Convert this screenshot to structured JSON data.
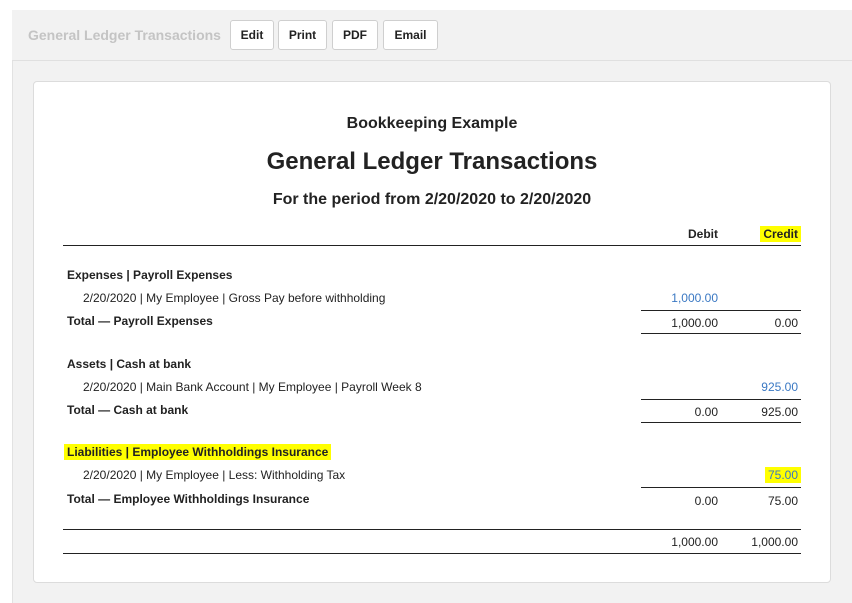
{
  "toolbar": {
    "title": "General Ledger Transactions",
    "buttons": {
      "edit": "Edit",
      "print": "Print",
      "pdf": "PDF",
      "email": "Email"
    }
  },
  "report": {
    "company": "Bookkeeping Example",
    "title": "General Ledger Transactions",
    "period": "For the period from 2/20/2020 to 2/20/2020",
    "columns": {
      "debit": "Debit",
      "credit": "Credit"
    },
    "sections": [
      {
        "heading": "Expenses | Payroll Expenses",
        "line": {
          "description": "2/20/2020 | My Employee | Gross Pay before withholding",
          "debit": "1,000.00",
          "credit": ""
        },
        "total": {
          "label": "Total — Payroll Expenses",
          "debit": "1,000.00",
          "credit": "0.00"
        }
      },
      {
        "heading": "Assets | Cash at bank",
        "line": {
          "description": "2/20/2020 | Main Bank Account | My Employee | Payroll Week 8",
          "debit": "",
          "credit": "925.00"
        },
        "total": {
          "label": "Total — Cash at bank",
          "debit": "0.00",
          "credit": "925.00"
        }
      },
      {
        "heading": "Liabilities | Employee Withholdings Insurance",
        "line": {
          "description": "2/20/2020 | My Employee | Less: Withholding Tax",
          "debit": "",
          "credit": "75.00"
        },
        "total": {
          "label": "Total — Employee Withholdings Insurance",
          "debit": "0.00",
          "credit": "75.00"
        }
      }
    ],
    "grand_total": {
      "debit": "1,000.00",
      "credit": "1,000.00"
    }
  },
  "colors": {
    "highlight": "#ffff00",
    "link": "#3a78c3"
  }
}
